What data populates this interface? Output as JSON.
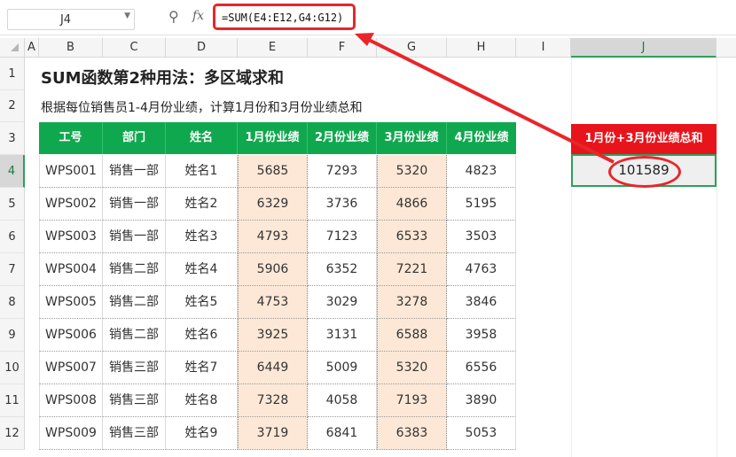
{
  "formula_bar": {
    "cell_ref": "J4",
    "dropdown_icon": "chevron-down-icon",
    "zoom_icon": "zoom-icon",
    "fx_label": "fx",
    "formula": "=SUM(E4:E12,G4:G12)"
  },
  "columns": [
    "A",
    "B",
    "C",
    "D",
    "E",
    "F",
    "G",
    "H",
    "I",
    "J"
  ],
  "rows": [
    "1",
    "2",
    "3",
    "4",
    "5",
    "6",
    "7",
    "8",
    "9",
    "10",
    "11",
    "12"
  ],
  "sheet": {
    "title": "SUM函数第2种用法：多区域求和",
    "subtitle": "根据每位销售员1-4月份业绩，计算1月份和3月份业绩总和",
    "headers": [
      "工号",
      "部门",
      "姓名",
      "1月份业绩",
      "2月份业绩",
      "3月份业绩",
      "4月份业绩"
    ],
    "data": [
      [
        "WPS001",
        "销售一部",
        "姓名1",
        "5685",
        "7293",
        "5320",
        "4823"
      ],
      [
        "WPS002",
        "销售一部",
        "姓名2",
        "6329",
        "3736",
        "4866",
        "5195"
      ],
      [
        "WPS003",
        "销售一部",
        "姓名3",
        "4793",
        "7123",
        "6533",
        "3503"
      ],
      [
        "WPS004",
        "销售二部",
        "姓名4",
        "5906",
        "6352",
        "7221",
        "4763"
      ],
      [
        "WPS005",
        "销售二部",
        "姓名5",
        "4753",
        "3029",
        "3278",
        "3846"
      ],
      [
        "WPS006",
        "销售二部",
        "姓名6",
        "3925",
        "3131",
        "6588",
        "3958"
      ],
      [
        "WPS007",
        "销售三部",
        "姓名7",
        "6449",
        "5009",
        "5320",
        "6556"
      ],
      [
        "WPS008",
        "销售三部",
        "姓名8",
        "7328",
        "4058",
        "7193",
        "3890"
      ],
      [
        "WPS009",
        "销售三部",
        "姓名9",
        "3719",
        "6841",
        "6383",
        "5053"
      ]
    ],
    "sum_header": "1月份+3月份业绩总和",
    "sum_value": "101589"
  },
  "colors": {
    "header_green": "#10a84f",
    "highlight_red": "#e8262a",
    "highlight_fill": "#fde8d7",
    "active_green": "#2ea05a"
  }
}
